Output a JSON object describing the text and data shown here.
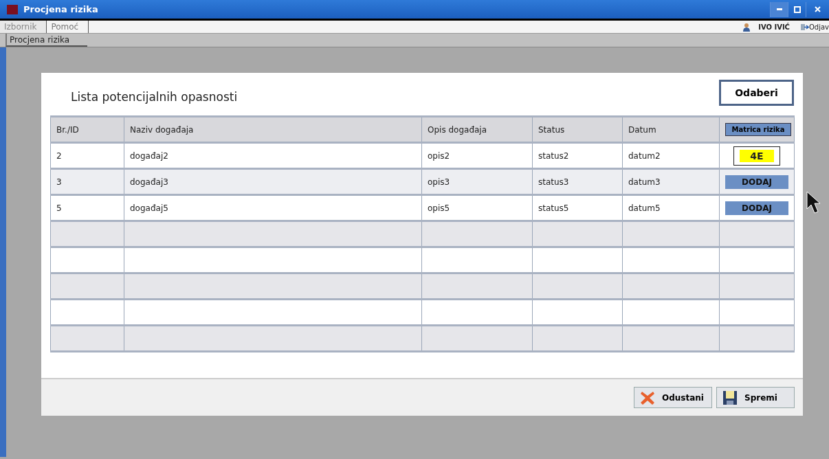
{
  "window": {
    "title": "Procjena rizika"
  },
  "menu": [
    {
      "label": "Izbornik",
      "disabled": true
    },
    {
      "label": "Pomoć",
      "disabled": false
    }
  ],
  "user": {
    "name": "IVO IVIĆ",
    "logout": "Odjav"
  },
  "tabs": [
    {
      "label": "Procjena rizika",
      "selected": true
    }
  ],
  "panel": {
    "title": "Lista potencijalnih opasnosti",
    "select_button": "Odaberi",
    "table": {
      "columns": [
        "Br./ID",
        "Naziv događaja",
        "Opis događaja",
        "Status",
        "Datum",
        "Matrica rizika"
      ],
      "rows": [
        {
          "id": "2",
          "name": "događaj2",
          "description": "opis2",
          "status": "status2",
          "date": "datum2",
          "risk": {
            "kind": "value",
            "text": "4E",
            "color": "#ffff00"
          }
        },
        {
          "id": "3",
          "name": "događaj3",
          "description": "opis3",
          "status": "status3",
          "date": "datum3",
          "risk": {
            "kind": "button",
            "text": "DODAJ"
          }
        },
        {
          "id": "5",
          "name": "događaj5",
          "description": "opis5",
          "status": "status5",
          "date": "datum5",
          "risk": {
            "kind": "button",
            "text": "DODAJ"
          }
        }
      ]
    }
  },
  "buttons": [
    {
      "kind": "cancel",
      "label": "Odustani"
    },
    {
      "kind": "save",
      "label": "Spremi"
    }
  ]
}
